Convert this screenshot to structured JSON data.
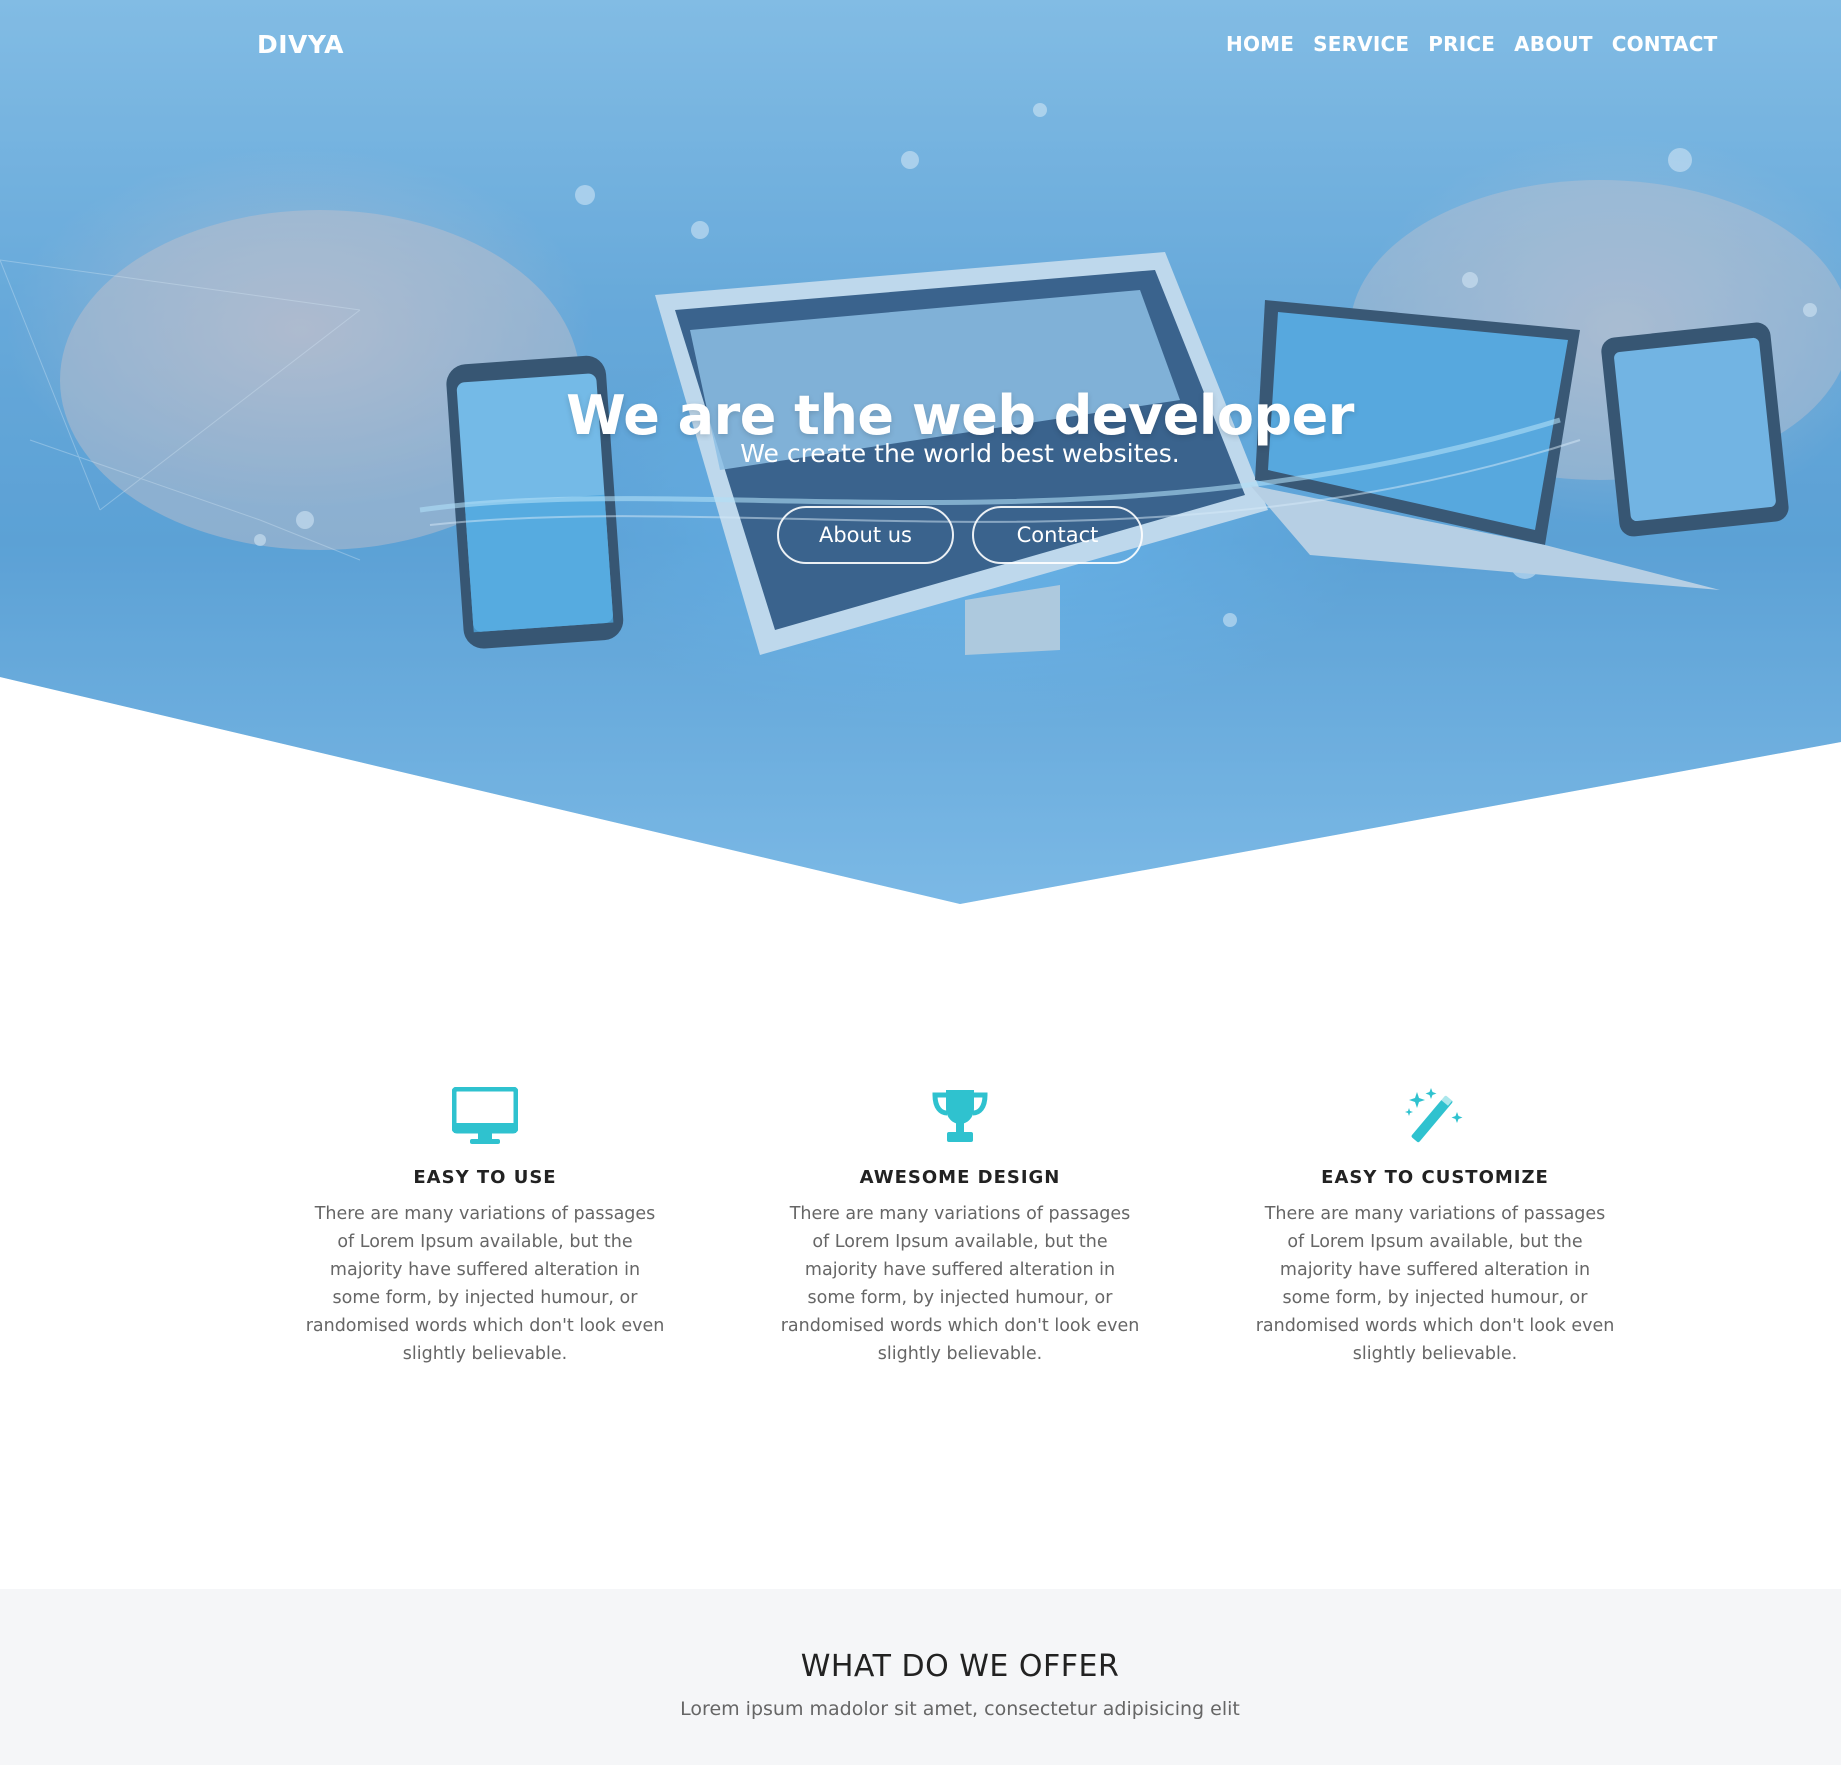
{
  "brand": {
    "logo": "DIVYA"
  },
  "nav": {
    "items": [
      "HOME",
      "SERVICE",
      "PRICE",
      "ABOUT",
      "CONTACT"
    ]
  },
  "hero": {
    "title": "We are the web developer",
    "subtitle": "We create the world best websites.",
    "about_button": "About us",
    "contact_button": "Contact"
  },
  "features": [
    {
      "icon": "monitor-icon",
      "title": "EASY  TO  USE",
      "text": "There are many variations of passages of Lorem Ipsum available, but the majority have suffered alteration in some form, by injected humour, or randomised words which don't look even slightly believable."
    },
    {
      "icon": "trophy-icon",
      "title": "AWESOME  DESIGN",
      "text": "There are many variations of passages of Lorem Ipsum available, but the majority have suffered alteration in some form, by injected humour, or randomised words which don't look even slightly believable."
    },
    {
      "icon": "magic-wand-icon",
      "title": "EASY  TO  CUSTOMIZE",
      "text": "There are many variations of passages of Lorem Ipsum available, but the majority have suffered alteration in some form, by injected humour, or randomised words which don't look even slightly believable."
    }
  ],
  "offer": {
    "title": "WHAT DO WE OFFER",
    "subtitle": "Lorem ipsum madolor sit amet, consectetur adipisicing elit"
  },
  "colors": {
    "accent": "#2fc2cf",
    "hero_blue": "#6aa9d8",
    "offer_bg": "#f5f6f8"
  }
}
